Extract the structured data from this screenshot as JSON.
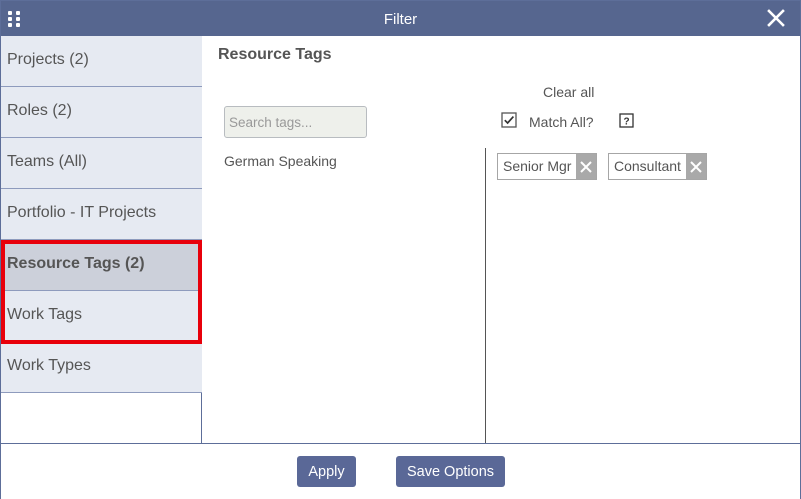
{
  "dialog": {
    "title": "Filter",
    "colors": {
      "titlebar": "#56668f",
      "button": "#5a6897",
      "highlight": "#e8000b",
      "sidebar_item": "#e6eaf2",
      "sidebar_active": "#ccd0da"
    }
  },
  "sidebar": {
    "items": [
      {
        "label": "Projects (2)"
      },
      {
        "label": "Roles (2)"
      },
      {
        "label": "Teams (All)"
      },
      {
        "label": "Portfolio - IT Projects"
      },
      {
        "label": "Resource Tags (2)",
        "active": true
      },
      {
        "label": "Work Tags"
      },
      {
        "label": "Work Types"
      }
    ]
  },
  "main": {
    "title": "Resource Tags",
    "search_placeholder": "Search tags...",
    "available_tags": [
      "German Speaking"
    ],
    "clear_all_label": "Clear all",
    "match_all_label": "Match All?",
    "match_all_checked": true,
    "selected_tags": [
      {
        "label": "Senior Mgr"
      },
      {
        "label": "Consultant"
      }
    ]
  },
  "footer": {
    "apply_label": "Apply",
    "save_options_label": "Save Options"
  },
  "icons": {
    "drag": "drag-handle-icon",
    "close": "close-icon",
    "checkbox": "checkbox-checked-icon",
    "help": "help-icon",
    "remove": "remove-tag-icon"
  }
}
